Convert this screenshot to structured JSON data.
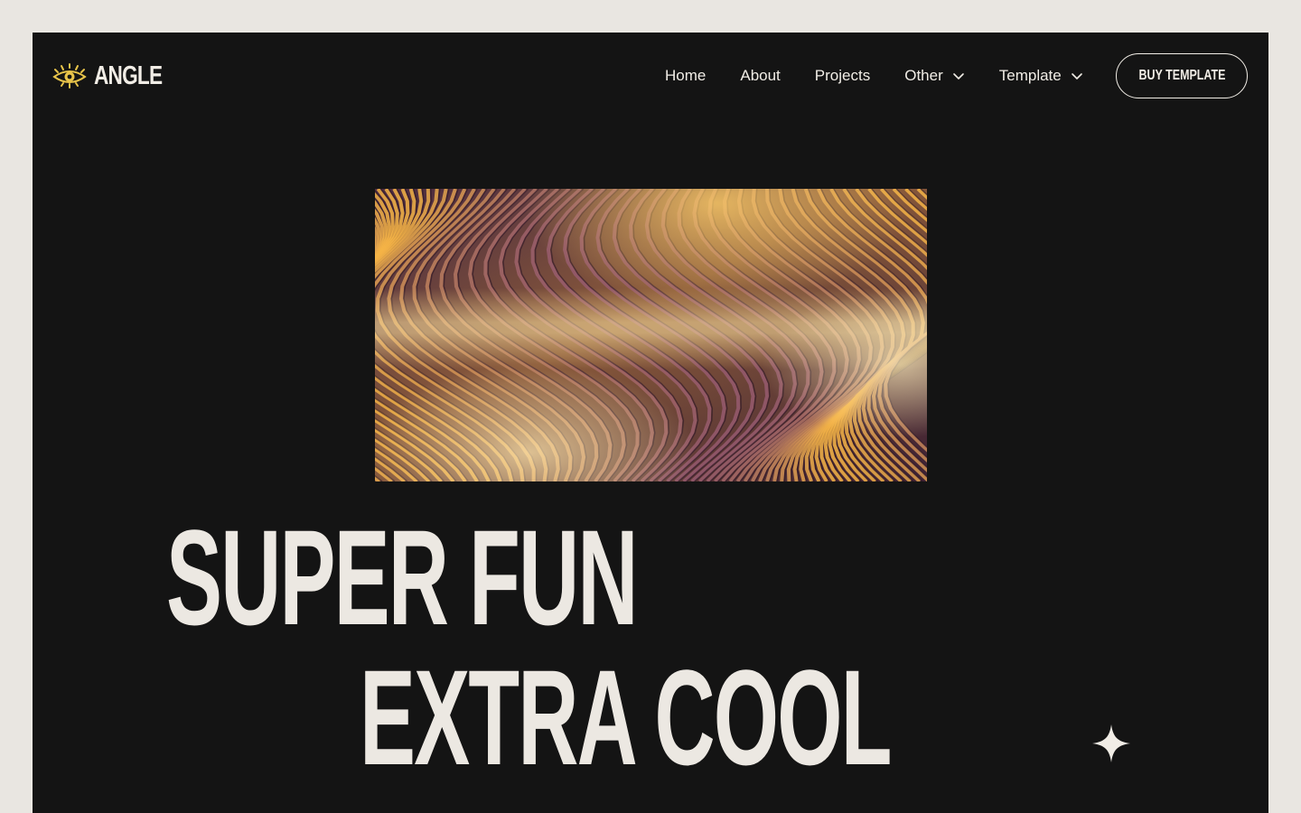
{
  "brand": {
    "name": "ANGLE",
    "logo_icon": "eye-icon",
    "accent_color": "#e8c44a"
  },
  "nav": {
    "items": [
      {
        "label": "Home",
        "has_dropdown": false
      },
      {
        "label": "About",
        "has_dropdown": false
      },
      {
        "label": "Projects",
        "has_dropdown": false
      },
      {
        "label": "Other",
        "has_dropdown": true
      },
      {
        "label": "Template",
        "has_dropdown": true
      }
    ],
    "cta_label": "BUY TEMPLATE"
  },
  "hero": {
    "image_icon": "abstract-wave-image",
    "headline_line1": "SUPER FUN",
    "headline_line2": "EXTRA COOL",
    "decor_icon": "sparkle-icon"
  },
  "colors": {
    "page_background": "#e9e6e1",
    "frame_background": "#141414",
    "text": "#f1ede6"
  }
}
